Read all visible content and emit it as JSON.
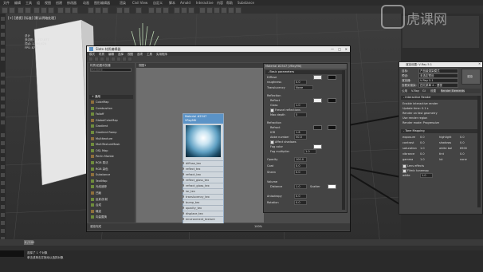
{
  "menu": [
    "文件",
    "编辑",
    "工具",
    "组",
    "视图",
    "创建",
    "修改器",
    "动画",
    "图形编辑器",
    "渲染",
    "Civil View",
    "自定义",
    "脚本",
    "Arnold",
    "Interactive",
    "内容",
    "帮助",
    "Substance"
  ],
  "viewport": {
    "label": "[+] [透视] [标准] [默认明暗处理]",
    "stats_title": "总计",
    "stats": [
      "多边形: 1,577,877",
      "顶点: 1,280,625",
      "FPS: 87.5"
    ],
    "scene_box_label": "VRayBitmap",
    "scene_list": [
      "Filters",
      "VRayBlend",
      "VRayColor2Bump",
      "VRayCurvature"
    ]
  },
  "slate": {
    "title": "Slate 材质编辑器",
    "menu": [
      "模式",
      "材质",
      "编辑",
      "选择",
      "视图",
      "选项",
      "工具",
      "实用程序"
    ],
    "browser_title": "材质/贴图浏览器",
    "search_placeholder": "按名称搜索...",
    "map_header": "+ 通用",
    "maps": [
      "ColorMap",
      "Combustion",
      "Falloff",
      "GlobalColorMap",
      "Gradient",
      "Gradient Ramp",
      "Multitexture",
      "MultiTextureMask",
      "OSL Map",
      "Perlin Marble",
      "RGB 乘法",
      "RGB 染色",
      "Substance",
      "TextMap",
      "光线追踪",
      "凹痕",
      "反射/折射",
      "合成",
      "噪波",
      "向量置换"
    ],
    "view_tab": "视图1",
    "node": {
      "title": "Material #2547",
      "subtitle": "VRayMtl",
      "slots": [
        "diffuse_tex",
        "reflect_tex",
        "refract_tex",
        "reflect_gloss_tex",
        "refract_gloss_tex",
        "ior_tex",
        "translucency_tex",
        "bump_tex",
        "opacity_tex",
        "displace_tex",
        "environment_texture"
      ]
    },
    "status": "渲染完成",
    "nav_zoom": "100%"
  },
  "params": {
    "title": "Material #2547 (VRayMtl)",
    "section_basic": "- Basic parameters",
    "diffuse_label": "Diffuse",
    "diffuse_val": "Diffuse",
    "roughness_label": "roughness",
    "roughness_val": "0.0",
    "translucency_label": "Translucency",
    "trans_none": "None",
    "reflection_label": "Reflection",
    "reflect_label": "Reflect",
    "gloss_label": "Gloss",
    "gloss_val": "1.0",
    "fresnel_label": "Fresnel reflections",
    "max_depth_label": "Max depth",
    "max_depth_val": "5",
    "refraction_label": "Refraction",
    "refract_label": "Refract",
    "ior_label": "IOR",
    "ior_val": "1.6",
    "abbe_label": "Abbe number",
    "abbe_val": "50.0",
    "affect_shadows": "Affect shadows",
    "fog_color": "Fog color",
    "fog_mult": "Fog multiplier",
    "fog_mult_val": "1.0",
    "opacity_label": "Opacity",
    "opacity_val": "100.0",
    "coat_label": "Coat",
    "coat_val": "0.0",
    "sheen_label": "Sheen",
    "sheen_val": "0.0",
    "volume_label": "Volume",
    "distance_label": "Distance",
    "distance_val": "1.0",
    "scatter_label": "Scatter",
    "anisotropy_label": "Anisotropy",
    "anisotropy_val": "0.0",
    "rotation_label": "Rotation",
    "rotation_val": "0.0"
  },
  "render_setup": {
    "title": "渲染设置: V-Ray 5.1",
    "target_label": "目标:",
    "target_val": "产品级渲染模式",
    "preset_label": "预设:",
    "preset_val": "未选定预设",
    "renderer_label": "渲染器:",
    "renderer_val": "V-Ray 5.1",
    "save_label": "查看到渲染:",
    "save_val": "四元菜单 4 - 透视",
    "render_button": "渲染",
    "tabs": [
      "公用",
      "V-Ray",
      "GI",
      "设置",
      "Render Elements"
    ],
    "section_ir": "- Interactive Render",
    "ir_rows": [
      "Enable interactive render",
      "Update time: 0.1 s",
      "Render on fast geometry",
      "Use render region",
      "Render mode: Progressive"
    ],
    "section_tm": "- Tone Mapping",
    "tm_rows": [
      [
        "exposure",
        "0.0",
        "highlight",
        "0.0"
      ],
      [
        "contrast",
        "0.0",
        "shadows",
        "0.0"
      ],
      [
        "saturation",
        "1.0",
        "white bal",
        "6500"
      ],
      [
        "vibrance",
        "0.0",
        "tint",
        "0.0"
      ],
      [
        "gamma",
        "1.0",
        "lut",
        "none"
      ]
    ],
    "lens_effects": "Lens effects",
    "filmic": "Filmic tonemap",
    "white_label": "white",
    "white_val": "1.0"
  },
  "timeline": {
    "frame": "0 / 100",
    "status": "选择了 1 个对象",
    "prompt": "单击或单击并拖动以选择对象"
  },
  "watermark": "虎课网",
  "colors": {
    "accent": "#5b93c7",
    "window_bg": "#4a4a4a",
    "titlebar": "#eaeaea",
    "panel": "#2d2d2d",
    "red_selection": "#c0392b"
  }
}
